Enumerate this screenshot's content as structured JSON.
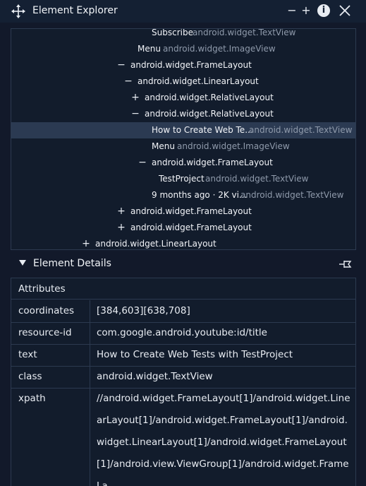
{
  "window": {
    "title": "Element Explorer",
    "controls": {
      "minimize": "−",
      "add": "+",
      "info": "i"
    }
  },
  "tree": {
    "rows": [
      {
        "toggle": "",
        "name": "Subscribe",
        "cls": "android.widget.TextView",
        "selected": false
      },
      {
        "toggle": "",
        "name": "Menu",
        "cls": "android.widget.ImageView",
        "selected": false
      },
      {
        "toggle": "−",
        "name": "android.widget.FrameLayout",
        "cls": "",
        "selected": false
      },
      {
        "toggle": "−",
        "name": "android.widget.LinearLayout",
        "cls": "",
        "selected": false
      },
      {
        "toggle": "+",
        "name": "android.widget.RelativeLayout",
        "cls": "",
        "selected": false
      },
      {
        "toggle": "−",
        "name": "android.widget.RelativeLayout",
        "cls": "",
        "selected": false
      },
      {
        "toggle": "",
        "name": "How to Create Web Te...",
        "cls": "android.widget.TextView",
        "selected": true
      },
      {
        "toggle": "",
        "name": "Menu",
        "cls": "android.widget.ImageView",
        "selected": false
      },
      {
        "toggle": "−",
        "name": "android.widget.FrameLayout",
        "cls": "",
        "selected": false
      },
      {
        "toggle": "",
        "name": "TestProject",
        "cls": "android.widget.TextView",
        "selected": false
      },
      {
        "toggle": "",
        "name": "9 months ago · 2K vi...",
        "cls": "android.widget.TextView",
        "selected": false
      },
      {
        "toggle": "+",
        "name": "android.widget.FrameLayout",
        "cls": "",
        "selected": false
      },
      {
        "toggle": "+",
        "name": "android.widget.FrameLayout",
        "cls": "",
        "selected": false
      },
      {
        "toggle": "+",
        "name": "android.widget.LinearLayout",
        "cls": "",
        "selected": false
      }
    ]
  },
  "details": {
    "title": "Element Details",
    "table_header": "Attributes",
    "rows": [
      {
        "key": "coordinates",
        "value": "[384,603][638,708]"
      },
      {
        "key": "resource-id",
        "value": "com.google.android.youtube:id/title"
      },
      {
        "key": "text",
        "value": "How to Create Web Tests with TestProject"
      },
      {
        "key": "class",
        "value": "android.widget.TextView"
      },
      {
        "key": "xpath",
        "value": "//android.widget.FrameLayout[1]/android.widget.LinearLayout[1]/android.widget.FrameLayout[1]/android.widget.LinearLayout[1]/android.widget.FrameLayout[1]/android.view.ViewGroup[1]/android.widget.FrameLa"
      }
    ]
  }
}
